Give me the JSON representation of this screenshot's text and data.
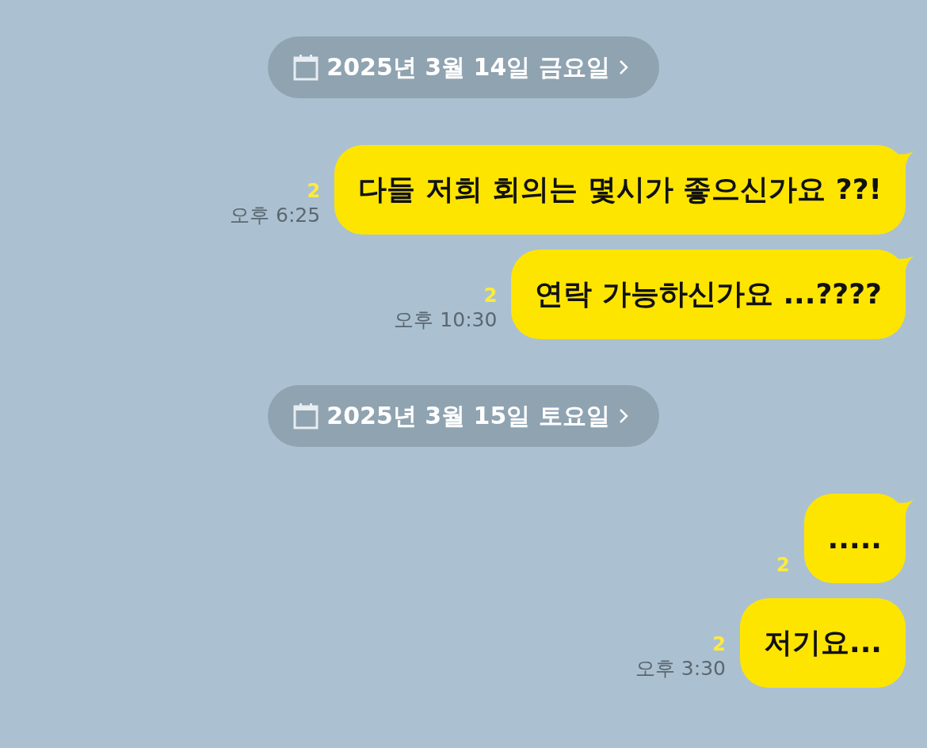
{
  "sections": [
    {
      "date": "2025년 3월 14일 금요일",
      "messages": [
        {
          "text": "다들 저희 회의는 몇시가 좋으신가요 ??!",
          "unread": "2",
          "time": "오후 6:25",
          "tail": true
        },
        {
          "text": "연락 가능하신가요 ...????",
          "unread": "2",
          "time": "오후 10:30",
          "tail": true
        }
      ]
    },
    {
      "date": "2025년 3월 15일 토요일",
      "messages": [
        {
          "text": ".....",
          "unread": "2",
          "tail": true
        },
        {
          "text": "저기요...",
          "unread": "2",
          "time": "오후 3:30",
          "tail": false
        }
      ]
    }
  ]
}
